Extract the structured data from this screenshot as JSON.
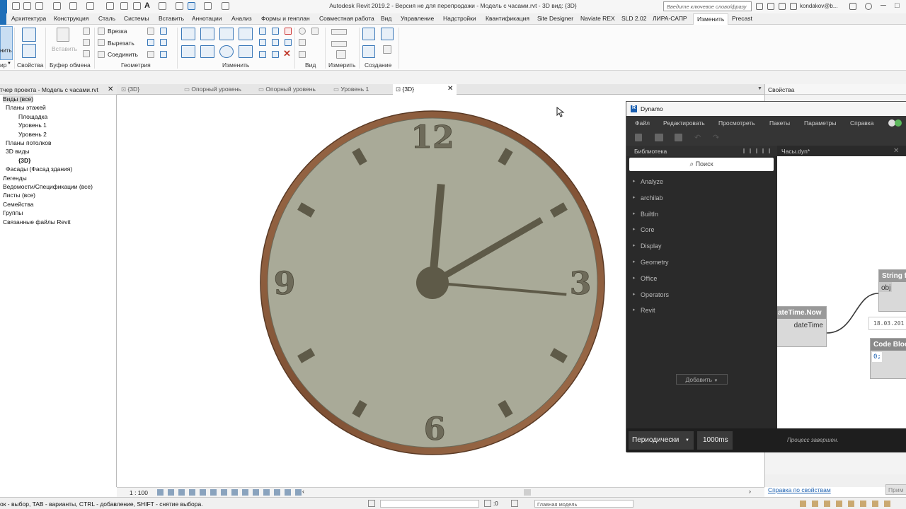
{
  "app": {
    "title": "Autodesk Revit 2019.2 - Версия не для перепродажи - Модель с часами.rvt - 3D вид: {3D}",
    "search_placeholder": "Введите ключевое слово/фразу",
    "user": "kondakov@b..."
  },
  "ribbon": {
    "tabs": [
      "Архитектура",
      "Конструкция",
      "Сталь",
      "Системы",
      "Вставить",
      "Аннотации",
      "Анализ",
      "Формы и генплан",
      "Совместная работа",
      "Вид",
      "Управление",
      "Надстройки",
      "Квантификация",
      "Site Designer",
      "Naviate REX",
      "SLD 2.02",
      "ЛИРА-САПР",
      "Изменить",
      "Precast"
    ],
    "active_tab": "Изменить",
    "groups": {
      "modify_left": "нить",
      "view_left": "ир",
      "properties": "Свойства",
      "clipboard": "Буфер обмена",
      "geometry": "Геометрия",
      "modify": "Изменить",
      "view": "Вид",
      "measure": "Измерить",
      "create": "Создание"
    },
    "buttons": {
      "paste": "Вставить",
      "cope": "Врезка",
      "cut": "Вырезать",
      "join": "Соединить"
    }
  },
  "browser": {
    "title": "тчер проекта - Модель с часами.rvt",
    "items": [
      {
        "label": "Виды (все)",
        "level": 0,
        "selected": true
      },
      {
        "label": "Планы этажей",
        "level": 1
      },
      {
        "label": "Площадка",
        "level": 2
      },
      {
        "label": "Уровень 1",
        "level": 2
      },
      {
        "label": "Уровень 2",
        "level": 2
      },
      {
        "label": "Планы потолков",
        "level": 1
      },
      {
        "label": "3D виды",
        "level": 1
      },
      {
        "label": "{3D}",
        "level": 2,
        "bold": true
      },
      {
        "label": "Фасады (Фасад здания)",
        "level": 1
      },
      {
        "label": "Легенды",
        "level": 0
      },
      {
        "label": "Ведомости/Спецификации (все)",
        "level": 0
      },
      {
        "label": "Листы (все)",
        "level": 0
      },
      {
        "label": "Семейства",
        "level": 0
      },
      {
        "label": "Группы",
        "level": 0
      },
      {
        "label": "Связанные файлы Revit",
        "level": 0
      }
    ]
  },
  "view_tabs": [
    {
      "label": "{3D}"
    },
    {
      "label": "Опорный уровень"
    },
    {
      "label": "Опорный уровень"
    },
    {
      "label": "Уровень 1"
    },
    {
      "label": "{3D}",
      "active": true
    }
  ],
  "clock": {
    "numerals": [
      "12",
      "3",
      "6",
      "9"
    ],
    "hour_hand_angle_deg": 5,
    "minute_hand_angle_deg": 60,
    "second_hand_angle_deg": 95,
    "colors": {
      "face": "#a9aa98",
      "rim": "#8a5a3a",
      "hands": "#5e5a48"
    }
  },
  "properties": {
    "title": "Свойства",
    "help_link": "Справка по свойствам",
    "apply": "Прим"
  },
  "view_control": {
    "scale": "1 : 100"
  },
  "status": {
    "hint": "ок - выбор, TAB - варианты, CTRL - добавление, SHIFT - снятие выбора.",
    "coord": ":0",
    "model": "Главная модель"
  },
  "dynamo": {
    "title": "Dynamo",
    "menu": [
      "Файл",
      "Редактировать",
      "Просмотреть",
      "Пакеты",
      "Параметры",
      "Справка"
    ],
    "library_title": "Библиотека",
    "search_placeholder": "Поиск",
    "library": [
      "Analyze",
      "archilab",
      "BuiltIn",
      "Core",
      "Display",
      "Geometry",
      "Office",
      "Operators",
      "Revit"
    ],
    "add_button": "Добавить",
    "graph_tab": "Часы.dyn*",
    "nodes": {
      "datetime_title": "ateTime.Now",
      "datetime_port": "dateTime",
      "stringfrom_title": "String fr",
      "stringfrom_port": "obj",
      "date_preview": "18.03.201",
      "codeblock_title": "Code Block",
      "codeblock_code": "0;"
    },
    "run_mode": "Периодически",
    "interval": "1000ms",
    "run_status": "Процесс завершен."
  }
}
